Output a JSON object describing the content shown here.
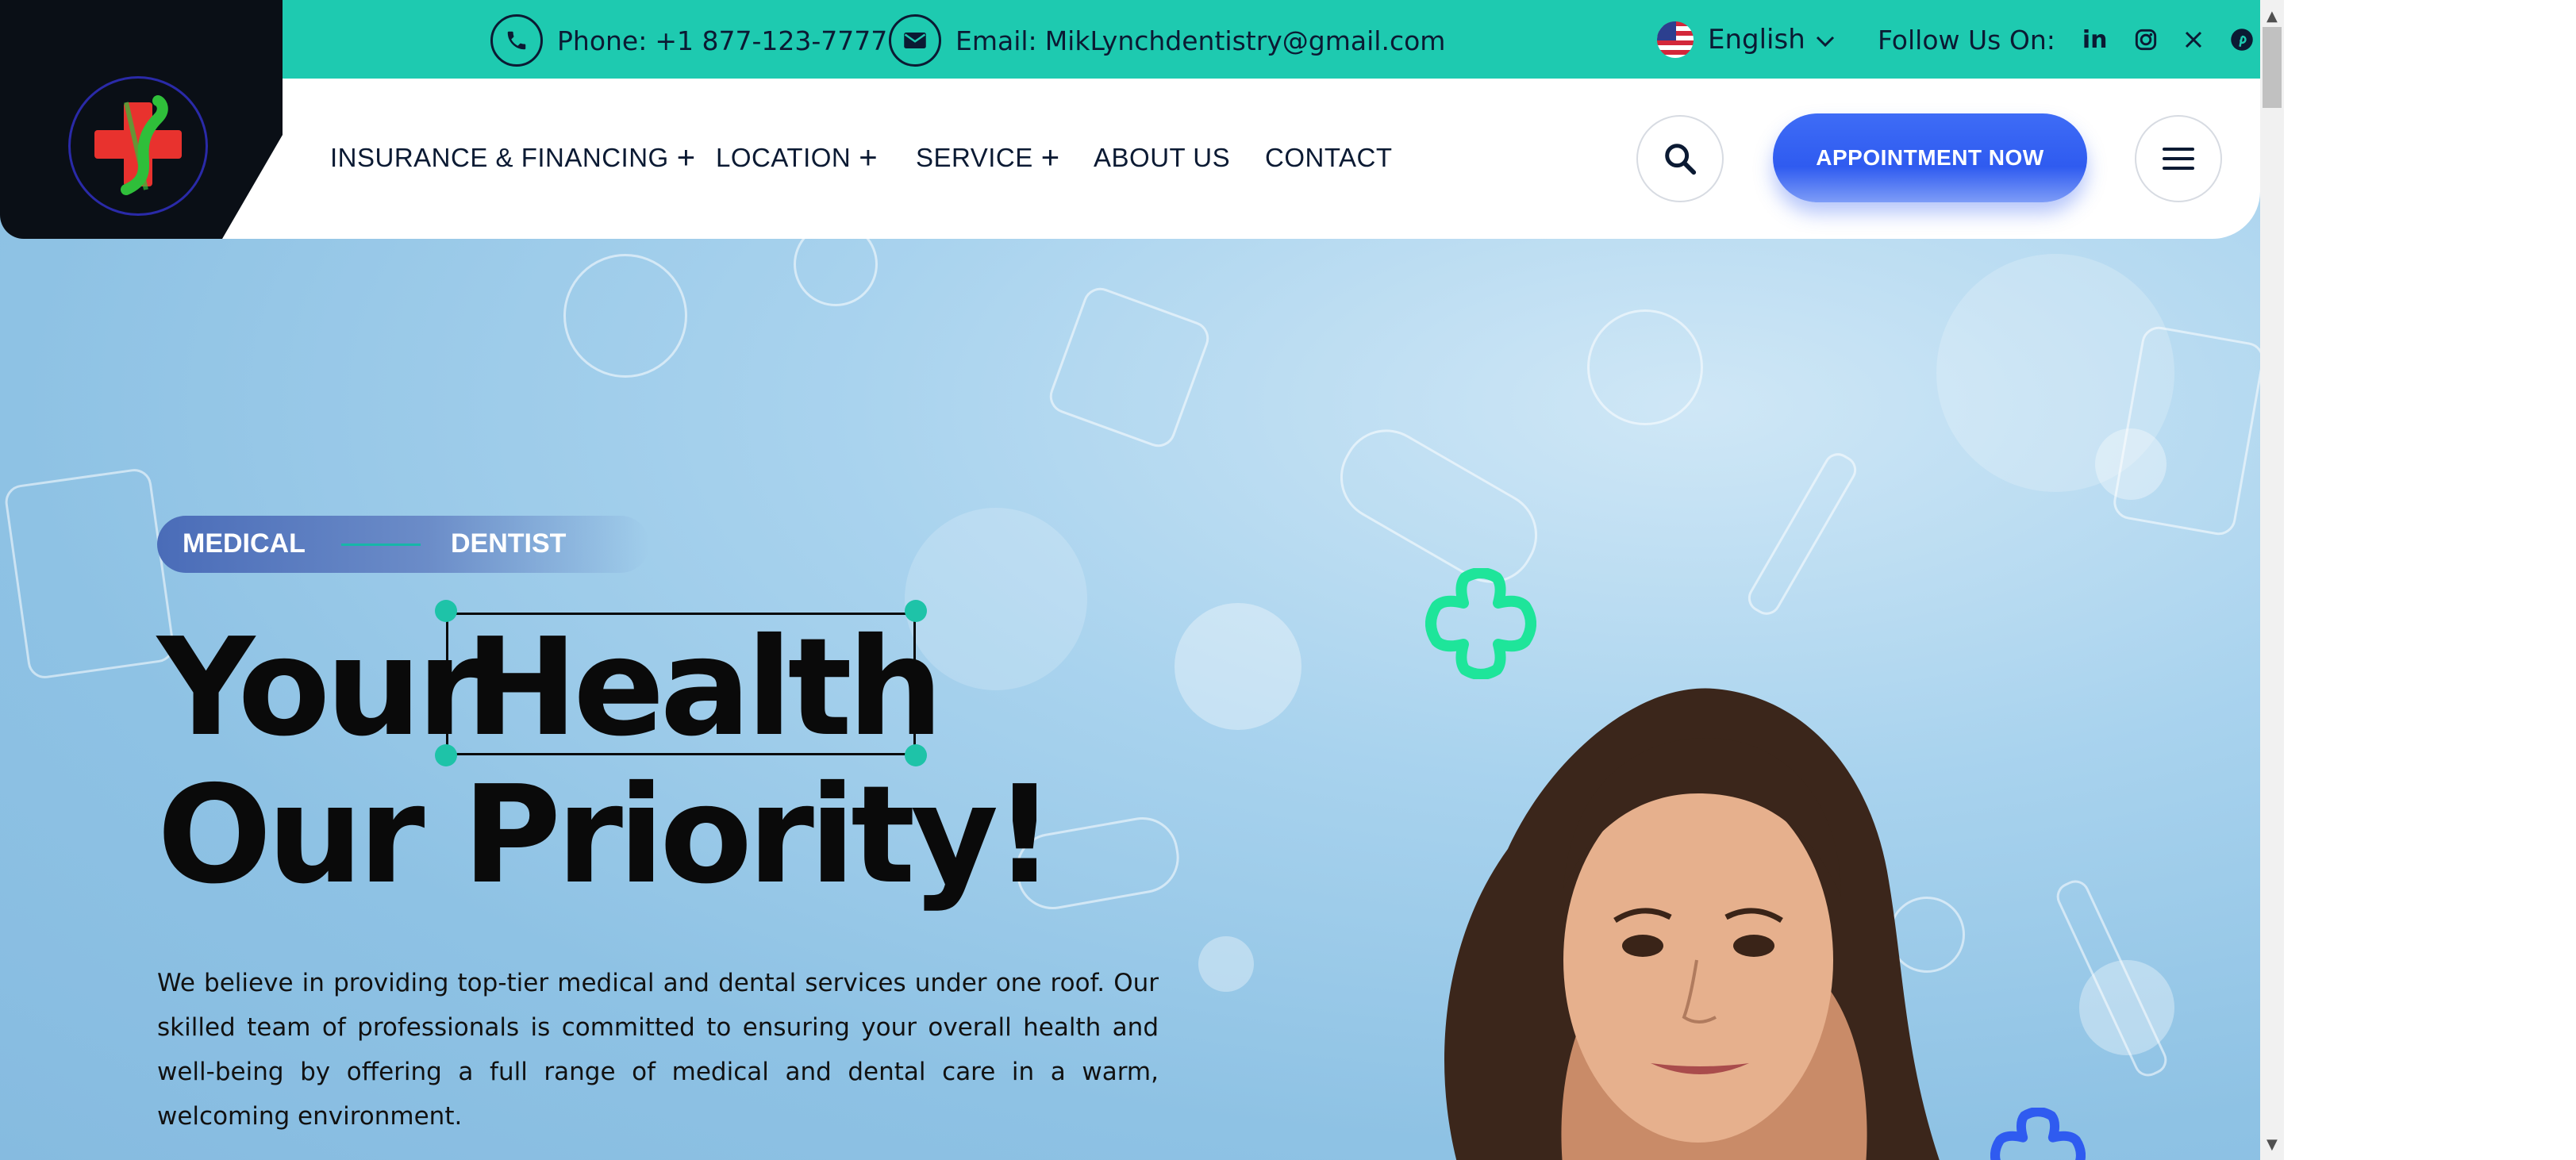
{
  "topbar": {
    "phone": {
      "label": "Phone:",
      "value": "+1 877-123-7777",
      "icon": "phone-icon"
    },
    "email": {
      "label": "Email:",
      "value": "MikLynchdentistry@gmail.com",
      "icon": "envelope-icon"
    },
    "language": {
      "value": "English",
      "icon": "us-flag-icon"
    },
    "follow": {
      "label": "Follow Us On:",
      "icons": [
        "linkedin-icon",
        "instagram-icon",
        "x-icon",
        "pinterest-icon"
      ]
    }
  },
  "nav": {
    "items": [
      {
        "label": "INSURANCE & FINANCING",
        "has_submenu": true
      },
      {
        "label": "LOCATION",
        "has_submenu": true
      },
      {
        "label": "SERVICE",
        "has_submenu": true
      },
      {
        "label": "ABOUT US",
        "has_submenu": false
      },
      {
        "label": "CONTACT",
        "has_submenu": false
      }
    ],
    "appointment_label": "APPOINTMENT NOW"
  },
  "hero": {
    "tag_left": "MEDICAL",
    "tag_right": "DENTIST",
    "headline_word1": "Your",
    "headline_word2": "Health",
    "headline_line2": "Our Priority!",
    "paragraph": "We believe in providing top-tier medical and dental services under one roof. Our skilled team of professionals is committed to ensuring your overall health and well-being by offering a full range of medical and dental care in a warm, welcoming environment."
  },
  "colors": {
    "topbar": "#1ecab0",
    "nav_bg": "#ffffff",
    "logo_bg": "#0a0f16",
    "appointment_button": "#2f5bf0",
    "hero_bg": "#a9d3ee",
    "accent_green": "#1ee59a",
    "accent_blue": "#2f5bf0"
  }
}
